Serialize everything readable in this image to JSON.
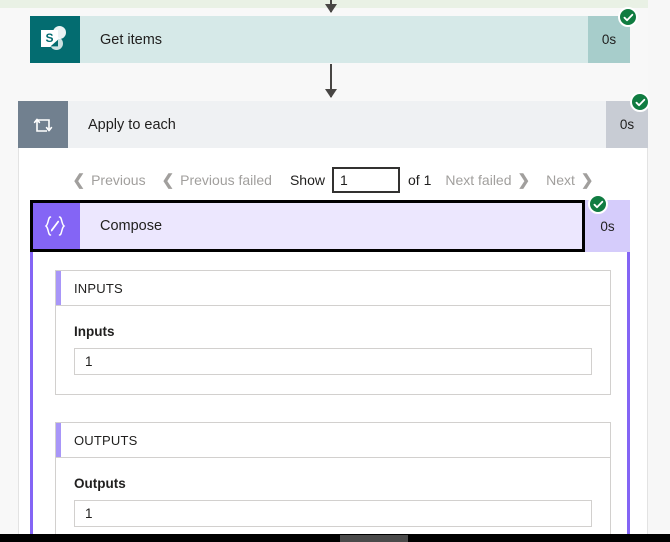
{
  "flow": {
    "steps": [
      {
        "id": "get-items",
        "title": "Get items",
        "duration": "0s",
        "status": "succeeded",
        "icon": "sharepoint-icon",
        "icon_bg": "#036c70",
        "body_bg": "#d6e9e8",
        "duration_bg": "#a7cdcb"
      },
      {
        "id": "apply-to-each",
        "title": "Apply to each",
        "duration": "0s",
        "status": "succeeded",
        "icon": "loop-foreach-icon",
        "icon_bg": "#71808f",
        "body_bg": "#eff1f3",
        "duration_bg": "#c8ccd4"
      },
      {
        "id": "compose",
        "title": "Compose",
        "duration": "0s",
        "status": "succeeded",
        "icon": "compose-braces-icon",
        "icon_bg": "#8465f5",
        "body_bg": "#ece7fe",
        "duration_bg": "#d5ccfb"
      }
    ]
  },
  "pager": {
    "previous_label": "Previous",
    "previous_failed_label": "Previous failed",
    "show_label": "Show",
    "page_value": "1",
    "page_placeholder": "",
    "of_label": "of 1",
    "next_failed_label": "Next failed",
    "next_label": "Next"
  },
  "compose_detail": {
    "inputs": {
      "header": "INPUTS",
      "field_label": "Inputs",
      "field_value": "1"
    },
    "outputs": {
      "header": "OUTPUTS",
      "field_label": "Outputs",
      "field_value": "1"
    }
  },
  "colors": {
    "accent_purple": "#8465f5",
    "accent_purple_light": "#a896f8",
    "success_green": "#107c41",
    "sharepoint_teal": "#036c70",
    "loop_grey": "#71808f",
    "top_strip_green": "#e9f1e5"
  }
}
